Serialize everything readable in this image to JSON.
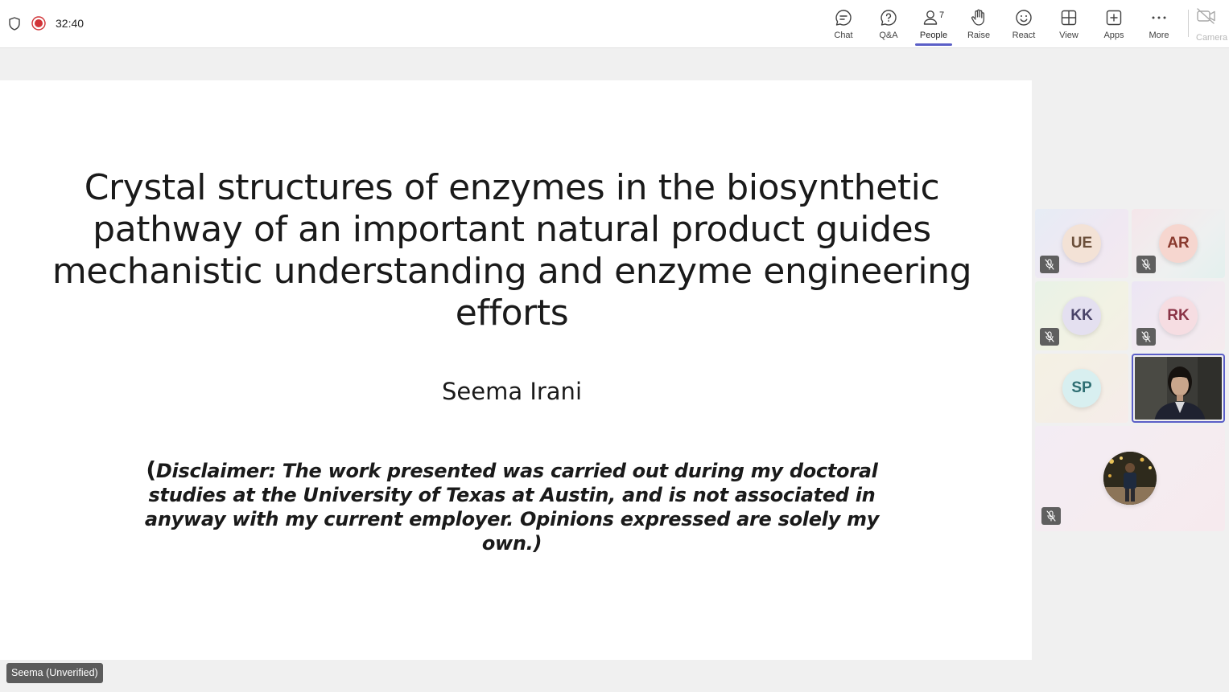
{
  "topbar": {
    "timer": "32:40",
    "actions": [
      {
        "label": "Chat",
        "icon": "chat-icon"
      },
      {
        "label": "Q&A",
        "icon": "qa-icon"
      },
      {
        "label": "People",
        "icon": "people-icon",
        "count": "7",
        "active": true
      },
      {
        "label": "Raise",
        "icon": "raise-hand-icon"
      },
      {
        "label": "React",
        "icon": "react-icon"
      },
      {
        "label": "View",
        "icon": "view-icon"
      },
      {
        "label": "Apps",
        "icon": "apps-icon"
      },
      {
        "label": "More",
        "icon": "more-icon"
      }
    ],
    "camera_label": "Camera"
  },
  "slide": {
    "title": "Crystal structures of enzymes in the biosynthetic pathway of an important natural product guides mechanistic understanding and enzyme engineering efforts",
    "author": "Seema Irani",
    "disclaimer_open": "(",
    "disclaimer": "Disclaimer: The work presented was carried out during my doctoral studies at the University of Texas at Austin, and is not associated in anyway with my current employer. Opinions expressed are solely my own.)"
  },
  "presenter_tag": "Seema (Unverified)",
  "participants": [
    {
      "initials": "UE",
      "muted": true
    },
    {
      "initials": "AR",
      "muted": true
    },
    {
      "initials": "KK",
      "muted": true
    },
    {
      "initials": "RK",
      "muted": true
    },
    {
      "initials": "SP",
      "muted": false
    },
    {
      "initials": "",
      "video": true
    },
    {
      "initials": "",
      "photo": true,
      "muted": true
    }
  ],
  "colors": {
    "accent": "#5b5fc7",
    "recording": "#d13438"
  }
}
